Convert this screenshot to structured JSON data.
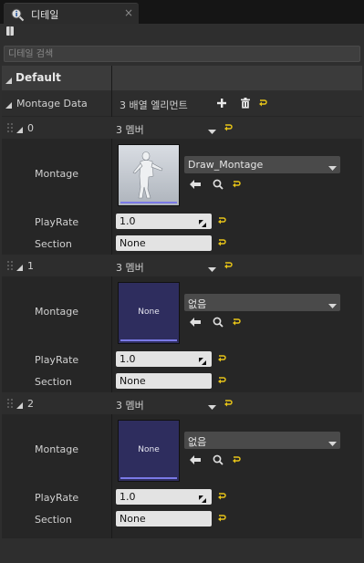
{
  "tab": {
    "title": "디테일",
    "icon": "magnifier-info-icon",
    "close": "×"
  },
  "toolbar": {
    "lock_icon": "lock-icon"
  },
  "search": {
    "placeholder": "디테일 검색"
  },
  "category": {
    "label": "Default"
  },
  "montage_data": {
    "label": "Montage Data",
    "summary": "3 배열 엘리먼트",
    "add_icon": "+",
    "reset_icon": "⮌"
  },
  "elements": [
    {
      "index": "0",
      "members": "3 멤버",
      "montage_label": "Montage",
      "asset": "Draw_Montage",
      "thumb_text": "",
      "playrate_label": "PlayRate",
      "playrate": "1.0",
      "section_label": "Section",
      "section": "None"
    },
    {
      "index": "1",
      "members": "3 멤버",
      "montage_label": "Montage",
      "asset": "없음",
      "thumb_text": "None",
      "playrate_label": "PlayRate",
      "playrate": "1.0",
      "section_label": "Section",
      "section": "None"
    },
    {
      "index": "2",
      "members": "3 멤버",
      "montage_label": "Montage",
      "asset": "없음",
      "thumb_text": "None",
      "playrate_label": "PlayRate",
      "playrate": "1.0",
      "section_label": "Section",
      "section": "None"
    }
  ],
  "colors": {
    "accent_reset": "#e6c318",
    "thumb_none": "#2e2d5e",
    "field_bg": "#e3e3e3"
  }
}
